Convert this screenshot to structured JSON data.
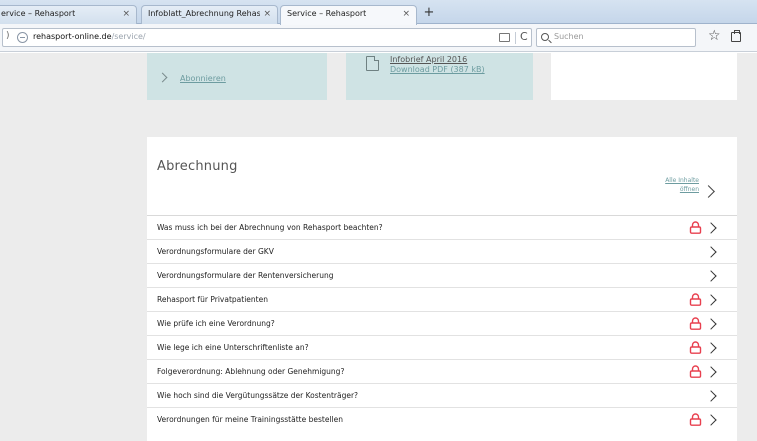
{
  "browser": {
    "tabs": [
      {
        "label": "ervice – Rehasport",
        "active": false
      },
      {
        "label": "Infoblatt_Abrechnung Rehaspo...",
        "active": false
      },
      {
        "label": "Service – Rehasport",
        "active": true
      }
    ],
    "tab_close_glyph": "×",
    "new_tab_glyph": "+",
    "url_domain": "rehasport-online.de",
    "url_path": "/service/",
    "search_placeholder": "Suchen"
  },
  "top_cards": {
    "subscribe_link": "Abonnieren",
    "info_title": "Infobrief April 2016",
    "download_link": "Download PDF (387 kB)"
  },
  "section": {
    "title": "Abrechnung",
    "expand_all_line1": "Alle Inhalte",
    "expand_all_line2": "öffnen"
  },
  "faq": [
    {
      "label": "Was muss ich bei der Abrechnung von Rehasport beachten?",
      "locked": true
    },
    {
      "label": "Verordnungsformulare der GKV",
      "locked": false
    },
    {
      "label": "Verordnungsformulare der Rentenversicherung",
      "locked": false
    },
    {
      "label": "Rehasport für Privatpatienten",
      "locked": true
    },
    {
      "label": "Wie prüfe ich eine Verordnung?",
      "locked": true
    },
    {
      "label": "Wie lege ich eine Unterschriftenliste an?",
      "locked": true
    },
    {
      "label": "Folgeverordnung: Ablehnung oder Genehmigung?",
      "locked": true
    },
    {
      "label": "Wie hoch sind die Vergütungssätze der Kostenträger?",
      "locked": false
    },
    {
      "label": "Verordnungen für meine Trainingsstätte bestellen",
      "locked": true
    }
  ],
  "colors": {
    "lock_accent": "#e8404f",
    "teal_card": "#cfe3e4",
    "link_teal": "#6d9ca0"
  },
  "icons": {
    "lock": "lock-icon",
    "chevron": "chevron-right-icon",
    "pdf": "document-icon",
    "star": "bookmark-star-icon"
  }
}
